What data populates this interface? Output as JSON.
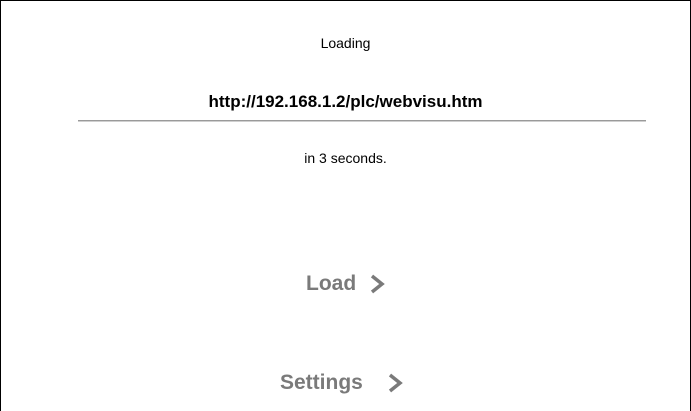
{
  "loading": {
    "label": "Loading",
    "url": "http://192.168.1.2/plc/webvisu.htm",
    "countdown_text": "in 3 seconds."
  },
  "buttons": {
    "load_label": "Load",
    "settings_label": "Settings"
  },
  "colors": {
    "background": "#ffffff",
    "text": "#000000",
    "button_text": "#7a7a7a",
    "divider": "#9a9a9a"
  },
  "icons": {
    "load_arrow": "chevron-right-icon",
    "settings_arrow": "chevron-right-icon"
  }
}
